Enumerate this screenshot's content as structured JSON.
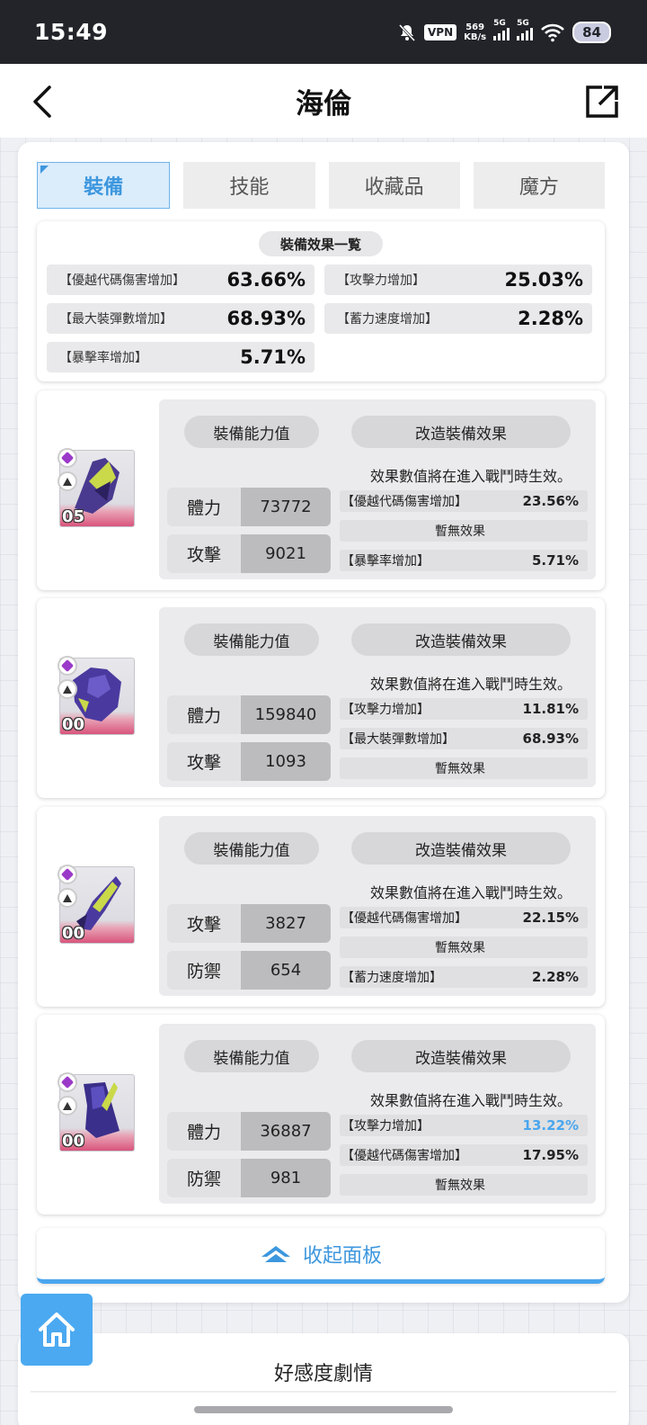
{
  "status_bar": {
    "time": "15:49",
    "vpn": "VPN",
    "speed_value": "569",
    "speed_unit": "KB/s",
    "net1": "5G",
    "net2": "5G",
    "battery": "84"
  },
  "header": {
    "title": "海倫",
    "back_icon": "chevron-left-icon",
    "share_icon": "external-link-icon"
  },
  "tabs": [
    {
      "label": "裝備",
      "active": true
    },
    {
      "label": "技能",
      "active": false
    },
    {
      "label": "收藏品",
      "active": false
    },
    {
      "label": "魔方",
      "active": false
    }
  ],
  "summary": {
    "title": "裝備效果一覧",
    "effects": [
      {
        "label": "【優越代碼傷害增加】",
        "value": "63.66%"
      },
      {
        "label": "【攻擊力增加】",
        "value": "25.03%"
      },
      {
        "label": "【最大裝彈數增加】",
        "value": "68.93%"
      },
      {
        "label": "【蓄力速度增加】",
        "value": "2.28%"
      },
      {
        "label": "【暴擊率增加】",
        "value": "5.71%"
      }
    ]
  },
  "equipment": [
    {
      "level": "05",
      "stat_header": "裝備能力值",
      "mod_header": "改造裝備效果",
      "note": "效果數值將在進入戰鬥時生效。",
      "stats": [
        {
          "k": "體力",
          "v": "73772"
        },
        {
          "k": "攻擊",
          "v": "9021"
        }
      ],
      "mods": [
        {
          "label": "【優越代碼傷害增加】",
          "value": "23.56%"
        },
        {
          "label": "暫無效果",
          "value": ""
        },
        {
          "label": "【暴擊率增加】",
          "value": "5.71%"
        }
      ]
    },
    {
      "level": "00",
      "stat_header": "裝備能力值",
      "mod_header": "改造裝備效果",
      "note": "效果數值將在進入戰鬥時生效。",
      "stats": [
        {
          "k": "體力",
          "v": "159840"
        },
        {
          "k": "攻擊",
          "v": "1093"
        }
      ],
      "mods": [
        {
          "label": "【攻擊力增加】",
          "value": "11.81%"
        },
        {
          "label": "【最大裝彈數增加】",
          "value": "68.93%"
        },
        {
          "label": "暫無效果",
          "value": ""
        }
      ]
    },
    {
      "level": "00",
      "stat_header": "裝備能力值",
      "mod_header": "改造裝備效果",
      "note": "效果數值將在進入戰鬥時生效。",
      "stats": [
        {
          "k": "攻擊",
          "v": "3827"
        },
        {
          "k": "防禦",
          "v": "654"
        }
      ],
      "mods": [
        {
          "label": "【優越代碼傷害增加】",
          "value": "22.15%"
        },
        {
          "label": "暫無效果",
          "value": ""
        },
        {
          "label": "【蓄力速度增加】",
          "value": "2.28%"
        }
      ]
    },
    {
      "level": "00",
      "stat_header": "裝備能力值",
      "mod_header": "改造裝備效果",
      "note": "效果數值將在進入戰鬥時生效。",
      "stats": [
        {
          "k": "體力",
          "v": "36887"
        },
        {
          "k": "防禦",
          "v": "981"
        }
      ],
      "mods": [
        {
          "label": "【攻擊力增加】",
          "value": "13.22%",
          "highlight": "#4aa6ee"
        },
        {
          "label": "【優越代碼傷害增加】",
          "value": "17.95%"
        },
        {
          "label": "暫無效果",
          "value": ""
        }
      ]
    }
  ],
  "collapse": {
    "label": "收起面板",
    "icon": "chevron-up-icon"
  },
  "home": {
    "icon": "home-icon"
  },
  "bottom_card": {
    "title": "好感度劇情"
  },
  "colors": {
    "accent": "#3d97de",
    "rare": "#9b39c9",
    "thumb_bottom": "#d9557c"
  }
}
